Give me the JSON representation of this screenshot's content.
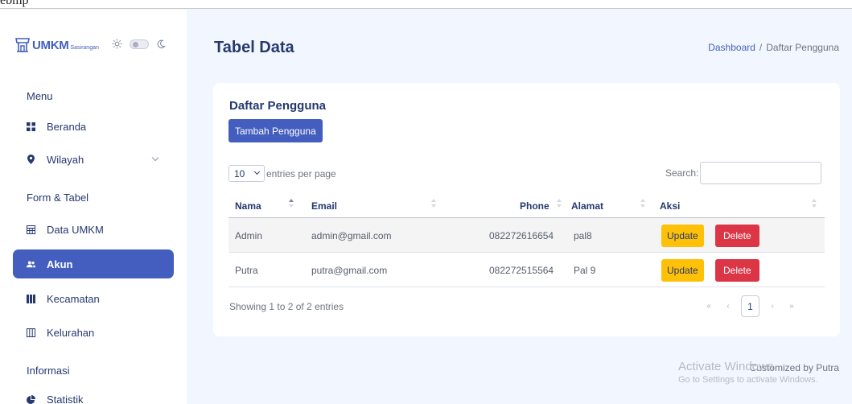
{
  "top_strip_text": "ebmp",
  "sidebar": {
    "brand": {
      "name": "UMKM",
      "sub": "Sasirangan"
    },
    "sections": [
      {
        "title": "Menu"
      },
      {
        "title": "Form & Tabel"
      },
      {
        "title": "Informasi"
      }
    ],
    "items": [
      {
        "label": "Beranda",
        "icon": "grid-icon"
      },
      {
        "label": "Wilayah",
        "icon": "map-pin-icon"
      },
      {
        "label": "Data UMKM",
        "icon": "table-icon"
      },
      {
        "label": "Akun",
        "icon": "users-icon",
        "active": true
      },
      {
        "label": "Kecamatan",
        "icon": "columns-icon"
      },
      {
        "label": "Kelurahan",
        "icon": "columns-outline-icon"
      },
      {
        "label": "Statistik",
        "icon": "pie-chart-icon"
      }
    ]
  },
  "header": {
    "title": "Tabel Data",
    "breadcrumb": [
      "Dashboard",
      "Daftar Pengguna"
    ]
  },
  "card": {
    "title": "Daftar Pengguna",
    "add_button": "Tambah Pengguna",
    "per_page_value": "10",
    "per_page_label": "entries per page",
    "search_label": "Search:",
    "search_value": "",
    "columns": [
      "Nama",
      "Email",
      "Phone",
      "Alamat",
      "Aksi"
    ],
    "rows": [
      {
        "nama": "Admin",
        "email": "admin@gmail.com",
        "phone": "082272616654",
        "alamat": "pal8"
      },
      {
        "nama": "Putra",
        "email": "putra@gmail.com",
        "phone": "082272515564",
        "alamat": "Pal 9"
      }
    ],
    "update_label": "Update",
    "delete_label": "Delete",
    "info": "Showing 1 to 2 of 2 entries",
    "pager": {
      "first": "«",
      "prev": "‹",
      "current": "1",
      "next": "›",
      "last": "»"
    }
  },
  "footer": "Customized by Putra",
  "watermark": {
    "line1": "Activate Windows",
    "line2": "Go to Settings to activate Windows."
  },
  "colors": {
    "primary": "#435ebe",
    "warning": "#ffc107",
    "danger": "#dc3545",
    "background": "#f2f7ff"
  }
}
